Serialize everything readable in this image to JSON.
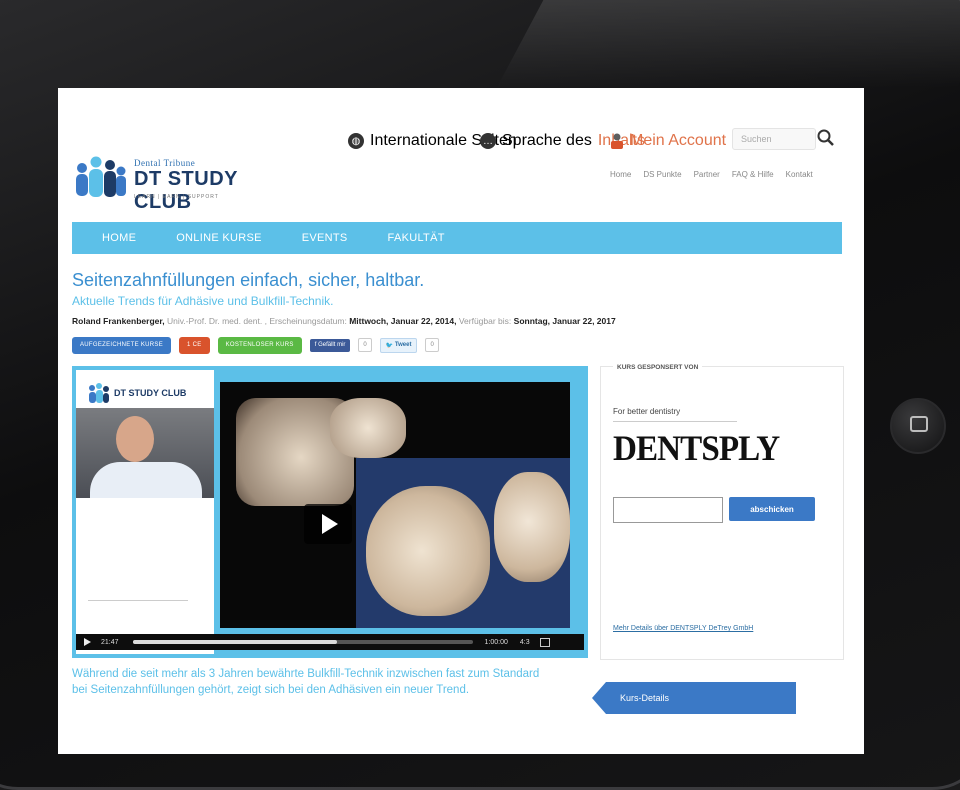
{
  "topbar": {
    "international": "Internationale Seiten",
    "language_prefix": "Sprache des",
    "language_link": "Inhalts",
    "account": "Mein Account",
    "search_placeholder": "Suchen"
  },
  "secondary_nav": [
    "Home",
    "DS Punkte",
    "Partner",
    "FAQ & Hilfe",
    "Kontakt"
  ],
  "logo": {
    "brand": "Dental Tribune",
    "title": "DT STUDY CLUB",
    "tagline": "LEARN | EARN | SUPPORT"
  },
  "main_nav": [
    "HOME",
    "ONLINE KURSE",
    "EVENTS",
    "FAKULTÄT"
  ],
  "course": {
    "title": "Seitenzahnfüllungen einfach, sicher, haltbar.",
    "subtitle": "Aktuelle Trends für Adhäsive und Bulkfill-Technik.",
    "author": "Roland Frankenberger,",
    "author_title": "Univ.-Prof. Dr. med. dent. ,",
    "release_label": "Erscheinungsdatum:",
    "release_date": "Mittwoch, Januar 22, 2014,",
    "available_label": "Verfügbar bis:",
    "available_date": "Sonntag, Januar 22, 2017",
    "description": "Während die seit mehr als 3 Jahren bewährte Bulkfill-Technik inzwischen fast zum Standard bei Seitenzahnfüllungen gehört, zeigt sich bei den Adhäsiven ein neuer Trend."
  },
  "badges": {
    "recorded": "AUFGEZEICHNETE KURSE",
    "ce": "1 CE",
    "free": "KOSTENLOSER KURS",
    "facebook": "Gefällt mir",
    "facebook_count": "0",
    "tweet": "Tweet",
    "tweet_count": "0"
  },
  "player": {
    "logo_text": "DT STUDY CLUB",
    "time_current": "21:47",
    "time_total": "1:00:00",
    "speed": "4:3",
    "progress": 0.6
  },
  "sponsor": {
    "heading": "KURS GESPONSERT VON",
    "tagline": "For better dentistry",
    "logo": "DENTSPLY",
    "submit": "abschicken",
    "link": "Mehr Details über DENTSPLY DeTrey GmbH"
  },
  "details_button": "Kurs-Details",
  "colors": {
    "nav": "#5cc0e8",
    "title": "#3a8fd0",
    "button": "#3b79c6"
  }
}
